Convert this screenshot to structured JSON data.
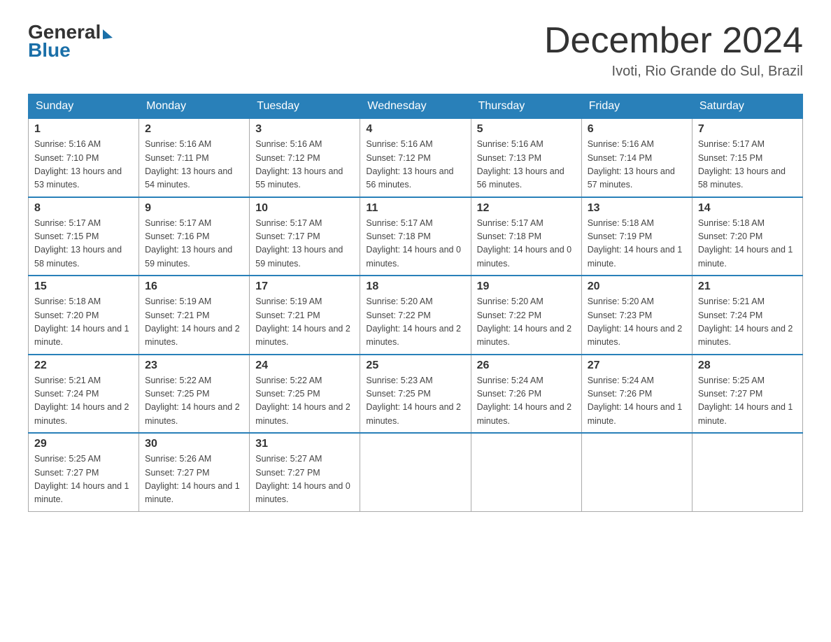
{
  "logo": {
    "general": "General",
    "blue": "Blue",
    "tagline": "Blue"
  },
  "header": {
    "title": "December 2024",
    "location": "Ivoti, Rio Grande do Sul, Brazil"
  },
  "weekdays": [
    "Sunday",
    "Monday",
    "Tuesday",
    "Wednesday",
    "Thursday",
    "Friday",
    "Saturday"
  ],
  "weeks": [
    [
      {
        "day": "1",
        "sunrise": "5:16 AM",
        "sunset": "7:10 PM",
        "daylight": "13 hours and 53 minutes."
      },
      {
        "day": "2",
        "sunrise": "5:16 AM",
        "sunset": "7:11 PM",
        "daylight": "13 hours and 54 minutes."
      },
      {
        "day": "3",
        "sunrise": "5:16 AM",
        "sunset": "7:12 PM",
        "daylight": "13 hours and 55 minutes."
      },
      {
        "day": "4",
        "sunrise": "5:16 AM",
        "sunset": "7:12 PM",
        "daylight": "13 hours and 56 minutes."
      },
      {
        "day": "5",
        "sunrise": "5:16 AM",
        "sunset": "7:13 PM",
        "daylight": "13 hours and 56 minutes."
      },
      {
        "day": "6",
        "sunrise": "5:16 AM",
        "sunset": "7:14 PM",
        "daylight": "13 hours and 57 minutes."
      },
      {
        "day": "7",
        "sunrise": "5:17 AM",
        "sunset": "7:15 PM",
        "daylight": "13 hours and 58 minutes."
      }
    ],
    [
      {
        "day": "8",
        "sunrise": "5:17 AM",
        "sunset": "7:15 PM",
        "daylight": "13 hours and 58 minutes."
      },
      {
        "day": "9",
        "sunrise": "5:17 AM",
        "sunset": "7:16 PM",
        "daylight": "13 hours and 59 minutes."
      },
      {
        "day": "10",
        "sunrise": "5:17 AM",
        "sunset": "7:17 PM",
        "daylight": "13 hours and 59 minutes."
      },
      {
        "day": "11",
        "sunrise": "5:17 AM",
        "sunset": "7:18 PM",
        "daylight": "14 hours and 0 minutes."
      },
      {
        "day": "12",
        "sunrise": "5:17 AM",
        "sunset": "7:18 PM",
        "daylight": "14 hours and 0 minutes."
      },
      {
        "day": "13",
        "sunrise": "5:18 AM",
        "sunset": "7:19 PM",
        "daylight": "14 hours and 1 minute."
      },
      {
        "day": "14",
        "sunrise": "5:18 AM",
        "sunset": "7:20 PM",
        "daylight": "14 hours and 1 minute."
      }
    ],
    [
      {
        "day": "15",
        "sunrise": "5:18 AM",
        "sunset": "7:20 PM",
        "daylight": "14 hours and 1 minute."
      },
      {
        "day": "16",
        "sunrise": "5:19 AM",
        "sunset": "7:21 PM",
        "daylight": "14 hours and 2 minutes."
      },
      {
        "day": "17",
        "sunrise": "5:19 AM",
        "sunset": "7:21 PM",
        "daylight": "14 hours and 2 minutes."
      },
      {
        "day": "18",
        "sunrise": "5:20 AM",
        "sunset": "7:22 PM",
        "daylight": "14 hours and 2 minutes."
      },
      {
        "day": "19",
        "sunrise": "5:20 AM",
        "sunset": "7:22 PM",
        "daylight": "14 hours and 2 minutes."
      },
      {
        "day": "20",
        "sunrise": "5:20 AM",
        "sunset": "7:23 PM",
        "daylight": "14 hours and 2 minutes."
      },
      {
        "day": "21",
        "sunrise": "5:21 AM",
        "sunset": "7:24 PM",
        "daylight": "14 hours and 2 minutes."
      }
    ],
    [
      {
        "day": "22",
        "sunrise": "5:21 AM",
        "sunset": "7:24 PM",
        "daylight": "14 hours and 2 minutes."
      },
      {
        "day": "23",
        "sunrise": "5:22 AM",
        "sunset": "7:25 PM",
        "daylight": "14 hours and 2 minutes."
      },
      {
        "day": "24",
        "sunrise": "5:22 AM",
        "sunset": "7:25 PM",
        "daylight": "14 hours and 2 minutes."
      },
      {
        "day": "25",
        "sunrise": "5:23 AM",
        "sunset": "7:25 PM",
        "daylight": "14 hours and 2 minutes."
      },
      {
        "day": "26",
        "sunrise": "5:24 AM",
        "sunset": "7:26 PM",
        "daylight": "14 hours and 2 minutes."
      },
      {
        "day": "27",
        "sunrise": "5:24 AM",
        "sunset": "7:26 PM",
        "daylight": "14 hours and 1 minute."
      },
      {
        "day": "28",
        "sunrise": "5:25 AM",
        "sunset": "7:27 PM",
        "daylight": "14 hours and 1 minute."
      }
    ],
    [
      {
        "day": "29",
        "sunrise": "5:25 AM",
        "sunset": "7:27 PM",
        "daylight": "14 hours and 1 minute."
      },
      {
        "day": "30",
        "sunrise": "5:26 AM",
        "sunset": "7:27 PM",
        "daylight": "14 hours and 1 minute."
      },
      {
        "day": "31",
        "sunrise": "5:27 AM",
        "sunset": "7:27 PM",
        "daylight": "14 hours and 0 minutes."
      },
      null,
      null,
      null,
      null
    ]
  ]
}
